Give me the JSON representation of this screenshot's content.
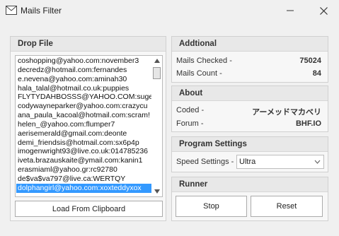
{
  "window": {
    "title": "Mails Filter",
    "minimize_icon": "minimize-icon",
    "close_icon": "close-icon",
    "app_icon": "envelope-icon"
  },
  "drop_file": {
    "header": "Drop File",
    "items": [
      "coshopping@yahoo.com:november3",
      "decredz@hotmail.com:fernandes",
      "e.nevena@yahoo.com:aminah30",
      "hala_talal@hotmail.co.uk:puppies",
      "FLYTYDAHBOSSS@YAHOO.COM:sugeir",
      "codywayneparker@yahoo.com:crazycu",
      "ana_paula_kacoal@hotmail.com:scram!",
      "helen_@yahoo.com:flumper7",
      "aerisemerald@gmail.com:deonte",
      "demi_friendsis@hotmail.com:sx6p4p",
      "imogenwright93@live.co.uk:014785236",
      "iveta.brazauskaite@ymail.com:kanin1",
      "erasmiaml@yahoo.gr:rc92780",
      "de$va$va797@live.ca:WERTQY",
      "dolphangirl@yahoo.com:xoxteddyxox"
    ],
    "selected_index": 14,
    "load_button": "Load From Clipboard"
  },
  "additional": {
    "header": "Addtional",
    "mails_checked_label": "Mails Checked -",
    "mails_checked_value": "75024",
    "mails_count_label": "Mails Count -",
    "mails_count_value": "84"
  },
  "about": {
    "header": "About",
    "coded_label": "Coded -",
    "coded_value": "アーメッドマカべリ",
    "forum_label": "Forum -",
    "forum_value": "BHF.IO"
  },
  "program_settings": {
    "header": "Program Settings",
    "speed_label": "Speed Settings -",
    "speed_value": "Ultra"
  },
  "runner": {
    "header": "Runner",
    "stop_button": "Stop",
    "reset_button": "Reset"
  }
}
